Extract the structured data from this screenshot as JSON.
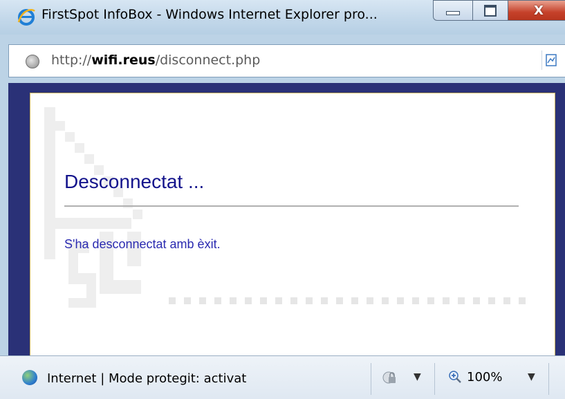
{
  "window": {
    "title": "FirstSpot InfoBox - Windows Internet Explorer pro...",
    "buttons": {
      "minimize": "minimize",
      "maximize": "maximize",
      "close": "X"
    }
  },
  "address": {
    "prefix": "http://",
    "domain": "wifi.reus",
    "path": "/disconnect.php"
  },
  "content": {
    "heading": "Desconnectat ...",
    "message": "S'ha desconnectat amb èxit."
  },
  "status": {
    "text": "Internet | Mode protegit: activat",
    "zoom": "100%"
  },
  "colors": {
    "frame": "#2a3177",
    "heading": "#14148c",
    "message": "#2a2ab0"
  },
  "icons": {
    "browser": "ie-icon",
    "page": "page-icon",
    "compat": "compat-view-icon",
    "globe": "globe-icon",
    "security": "lock-icon",
    "zoom": "zoom-icon"
  }
}
